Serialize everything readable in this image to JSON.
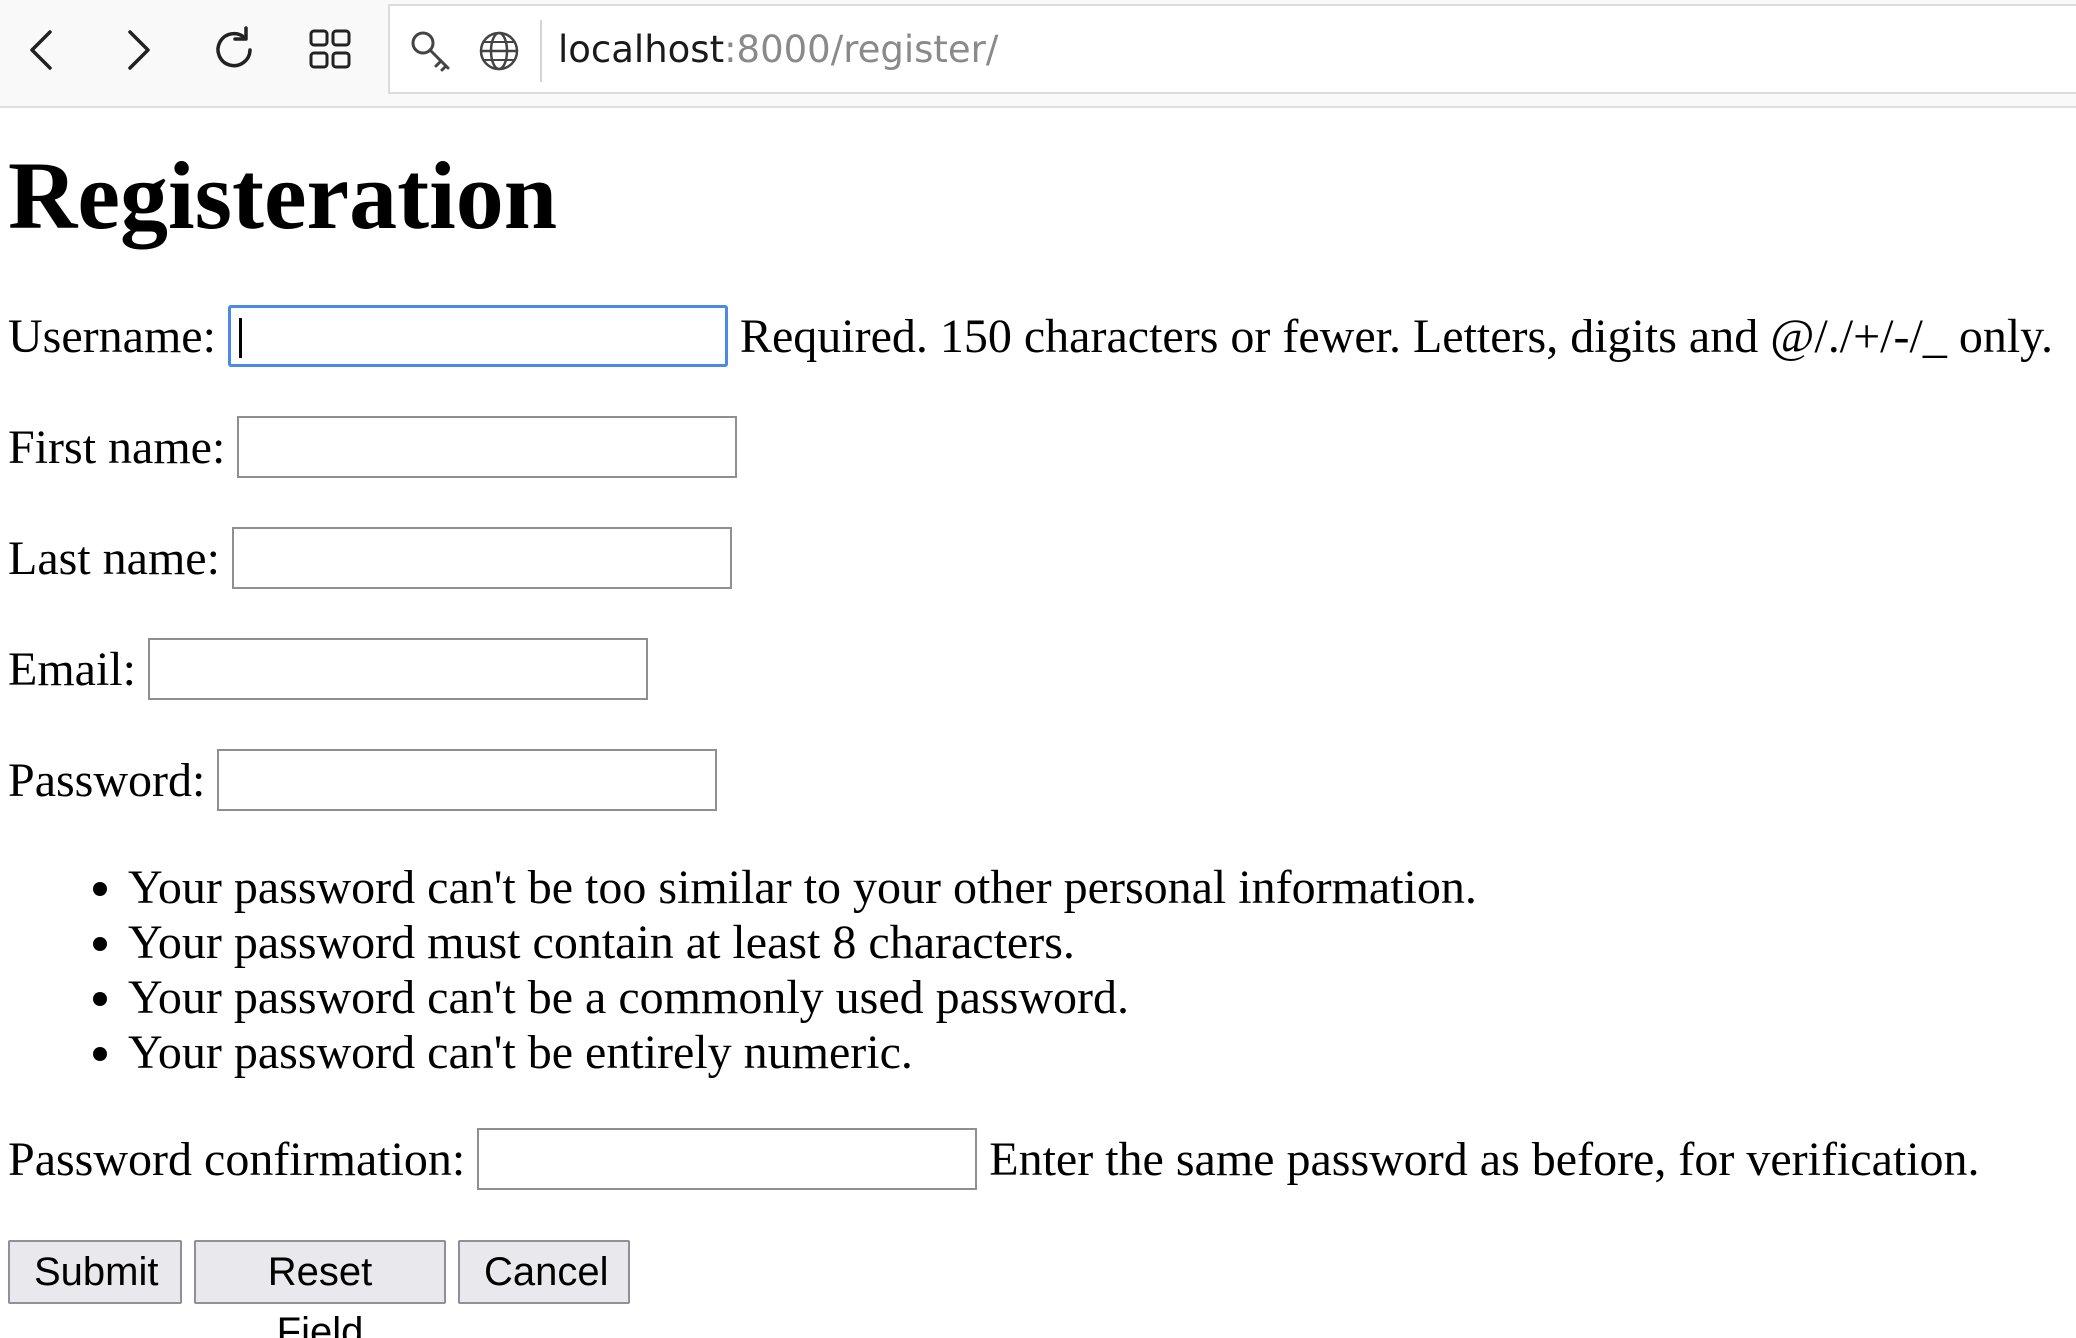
{
  "browser": {
    "url_host": "localhost",
    "url_rest": ":8000/register/",
    "icons": [
      "back-arrow-icon",
      "forward-arrow-icon",
      "reload-icon",
      "grid-icon",
      "key-icon",
      "globe-icon"
    ]
  },
  "page": {
    "title": "Registeration"
  },
  "form": {
    "username": {
      "label": "Username:",
      "value": "",
      "help": "Required. 150 characters or fewer. Letters, digits and @/./+/-/_ only.",
      "focused": true
    },
    "first_name": {
      "label": "First name:",
      "value": ""
    },
    "last_name": {
      "label": "Last name:",
      "value": ""
    },
    "email": {
      "label": "Email:",
      "value": ""
    },
    "password": {
      "label": "Password:",
      "value": "",
      "rules": [
        "Your password can't be too similar to your other personal information.",
        "Your password must contain at least 8 characters.",
        "Your password can't be a commonly used password.",
        "Your password can't be entirely numeric."
      ]
    },
    "password_confirmation": {
      "label": "Password confirmation:",
      "value": "",
      "help": "Enter the same password as before, for verification."
    }
  },
  "buttons": {
    "submit": "Submit",
    "reset": "Reset Field",
    "cancel": "Cancel"
  },
  "colors": {
    "focus_ring": "#4a8ae8",
    "button_bg": "#e9e9ed"
  }
}
